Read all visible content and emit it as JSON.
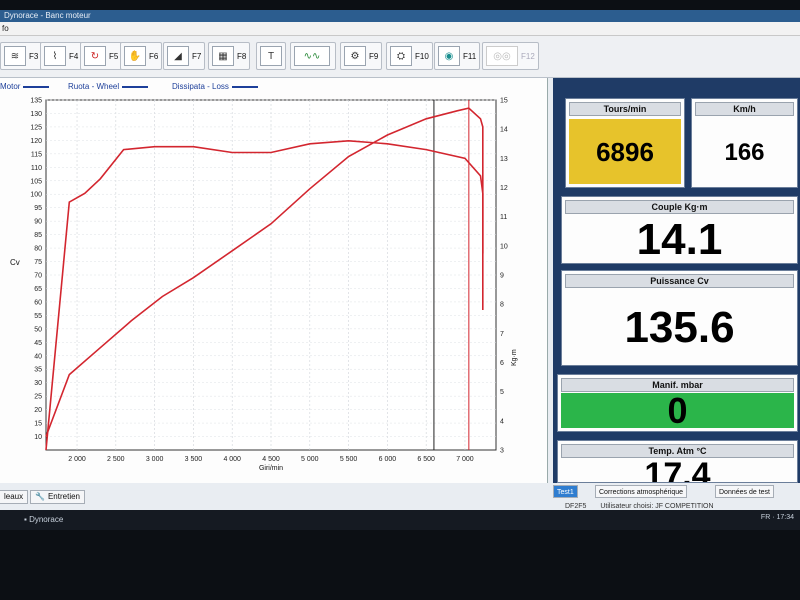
{
  "window": {
    "title": "Dynorace - Banc moteur",
    "menu_info": "fo"
  },
  "toolbar": {
    "buttons": [
      {
        "label": "F3",
        "icon": "curves-icon"
      },
      {
        "label": "F4",
        "icon": "graph-icon"
      },
      {
        "label": "F5",
        "icon": "reset-icon"
      },
      {
        "label": "F6",
        "icon": "hand-icon"
      },
      {
        "label": "F7",
        "icon": "ramp-icon"
      },
      {
        "label": "F8",
        "icon": "table-icon"
      },
      {
        "label": "",
        "icon": "text-icon"
      },
      {
        "label": "",
        "icon": "comparison-icon"
      },
      {
        "label": "F9",
        "icon": "engine-icon"
      },
      {
        "label": "F10",
        "icon": "gearbox-icon"
      },
      {
        "label": "F11",
        "icon": "globe-icon"
      },
      {
        "label": "F12",
        "icon": "roller-icon"
      }
    ]
  },
  "legend": {
    "motor": "Motor",
    "wheel": "Ruota - Wheel",
    "loss": "Dissipata - Loss"
  },
  "chart_data": {
    "type": "line",
    "xlabel": "Giri/min",
    "ylabel": "Cv",
    "y2label": "Kg·m",
    "xlim": [
      1600,
      7400
    ],
    "ylim": [
      5,
      135
    ],
    "y2lim": [
      3,
      15
    ],
    "x_ticks": [
      "2 000",
      "2 500",
      "3 000",
      "3 500",
      "4 000",
      "4 500",
      "5 000",
      "5 500",
      "6 000",
      "6 500",
      "7 000"
    ],
    "x_tick_values": [
      2000,
      2500,
      3000,
      3500,
      4000,
      4500,
      5000,
      5500,
      6000,
      6500,
      7000
    ],
    "y_ticks": [
      10,
      15,
      20,
      25,
      30,
      35,
      40,
      45,
      50,
      55,
      60,
      65,
      70,
      75,
      80,
      85,
      90,
      95,
      100,
      105,
      110,
      115,
      120,
      125,
      130,
      135
    ],
    "y2_ticks": [
      3,
      4,
      5,
      6,
      7,
      8,
      9,
      10,
      11,
      12,
      13,
      14,
      15
    ],
    "markers": [
      6600,
      7050
    ],
    "series": [
      {
        "color": "#d3262f",
        "axis": "left",
        "x": [
          1600,
          1900,
          2300,
          2700,
          3100,
          3500,
          4000,
          4500,
          5000,
          5500,
          6000,
          6500,
          6900,
          7050,
          7200,
          7230,
          7230
        ],
        "y": [
          10,
          33,
          43,
          53,
          62,
          69,
          79,
          89,
          102,
          114,
          122,
          128,
          131,
          132,
          128,
          125,
          78
        ]
      },
      {
        "color": "#d3262f",
        "axis": "right",
        "x": [
          1600,
          1900,
          2100,
          2300,
          2600,
          3000,
          3500,
          4000,
          4500,
          5000,
          5500,
          6000,
          6500,
          7000,
          7200,
          7230,
          7230
        ],
        "y": [
          3,
          11.5,
          11.8,
          12.3,
          13.3,
          13.4,
          13.4,
          13.2,
          13.2,
          13.5,
          13.6,
          13.5,
          13.3,
          13.0,
          12.4,
          11.8,
          7.8
        ]
      }
    ]
  },
  "gauges": {
    "rpm": {
      "label": "Tours/min",
      "value": "6896",
      "color": "#e7c32b"
    },
    "speed": {
      "label": "Km/h",
      "value": "166"
    },
    "torque": {
      "label": "Couple Kg·m",
      "value": "14.1"
    },
    "power": {
      "label": "Puissance Cv",
      "value": "135.6"
    },
    "manifold": {
      "label": "Manif. mbar",
      "value": "0",
      "color": "#2bb54a"
    },
    "temp": {
      "label": "Temp. Atm °C",
      "value": "17.4"
    }
  },
  "bottom_tabs": {
    "tableaux": "leaux",
    "entretien": "Entretien"
  },
  "right_tabs": {
    "test": "Test1",
    "corrections": "Corrections atmosphérique",
    "donnees": "Données de test"
  },
  "status": {
    "code": "DF2F5",
    "user": "Utilisateur choisi: JF COMPETITION"
  },
  "taskbar": {
    "app": "Dynorace",
    "tray": "FR · 17:34"
  }
}
